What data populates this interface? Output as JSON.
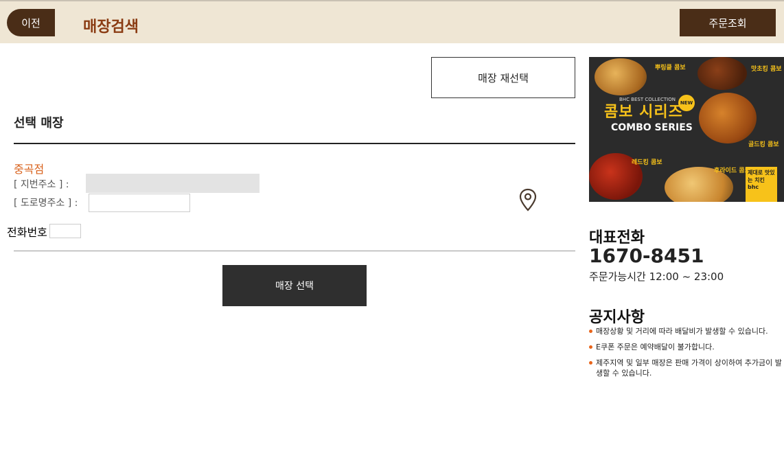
{
  "header": {
    "prev_label": "이전",
    "title": "매장검색",
    "order_lookup_label": "주문조회"
  },
  "main": {
    "reselect_label": "매장 재선택",
    "section_title": "선택 매장",
    "store_name": "중곡점",
    "jibun_label": "[ 지번주소 ] :",
    "jibun_value": "",
    "road_label": "[ 도로명주소 ] :",
    "road_value": "",
    "phone_label": "전화번호",
    "phone_value": "",
    "map_icon": "location-pin-icon",
    "select_label": "매장 선택"
  },
  "banner": {
    "headline_kr": "콤보 시리즈",
    "headline_en": "COMBO SERIES",
    "collection": "BHC BEST COLLECTION",
    "new_badge": "NEW",
    "items": [
      "뿌링클 콤보",
      "맛초킹 콤보",
      "골드킹 콤보",
      "레드킹 콤보",
      "후라이드 콤보"
    ],
    "slogan": "제대로 맛있는 치킨",
    "brand": "bhc"
  },
  "sidebar": {
    "rep_title": "대표전화",
    "rep_phone": "1670-8451",
    "hours": "주문가능시간 12:00 ~ 23:00",
    "notice_title": "공지사항",
    "notices": [
      "매장상황 및 거리에 따라 배달비가 발생할 수 있습니다.",
      "E쿠폰 주문은 예약배달이 불가합니다.",
      "제주지역 및 일부 매장은 판매 가격이 상이하여 추가금이 발생할 수 있습니다."
    ]
  },
  "colors": {
    "header_bg": "#efe6d4",
    "brand_brown": "#4a2d17",
    "title_color": "#8a3b12",
    "store_accent": "#d8601a",
    "select_button": "#2f2f2f"
  }
}
